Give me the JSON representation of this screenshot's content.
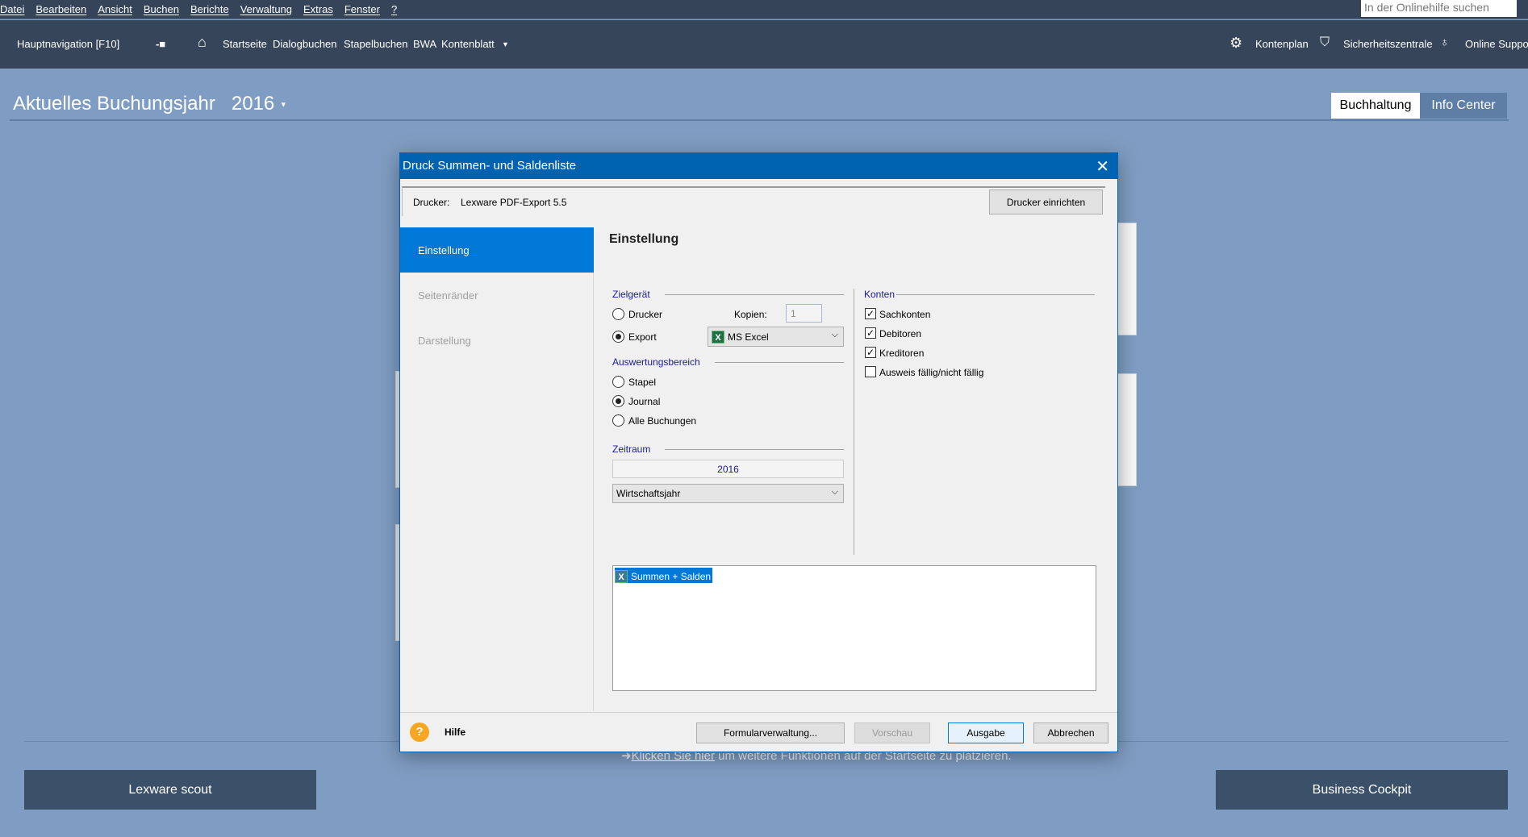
{
  "menu": [
    "Datei",
    "Bearbeiten",
    "Ansicht",
    "Buchen",
    "Berichte",
    "Verwaltung",
    "Extras",
    "Fenster",
    "?"
  ],
  "search": {
    "placeholder": "In der Onlinehilfe suchen"
  },
  "nav": {
    "main": "Hauptnavigation [F10]",
    "items": [
      "Startseite",
      "Dialogbuchen",
      "Stapelbuchen",
      "BWA",
      "Kontenblatt"
    ],
    "right": [
      "Kontenplan",
      "Sicherheitszentrale",
      "Online Support"
    ]
  },
  "header": {
    "title": "Aktuelles Buchungsjahr",
    "year": "2016",
    "tabs": [
      "Buchhaltung",
      "Info Center"
    ]
  },
  "hint": {
    "link": "Klicken Sie hier",
    "text": " um weitere Funktionen auf der Startseite zu platzieren."
  },
  "buttons": {
    "scout": "Lexware scout",
    "cockpit": "Business Cockpit"
  },
  "dialog": {
    "title": "Druck Summen- und Saldenliste",
    "printer_label": "Drucker:",
    "printer": "Lexware PDF-Export 5.5",
    "setup": "Drucker einrichten",
    "nav": [
      "Einstellung",
      "Seitenränder",
      "Darstellung"
    ],
    "heading": "Einstellung",
    "zielgeraet": "Zielgerät",
    "drucker": "Drucker",
    "export": "Export",
    "kopien_label": "Kopien:",
    "kopien": "1",
    "export_format": "MS Excel",
    "bereich": "Auswertungsbereich",
    "bereich_options": [
      "Stapel",
      "Journal",
      "Alle Buchungen"
    ],
    "bereich_selected": "Journal",
    "zeitraum": "Zeitraum",
    "zeitraum_year": "2016",
    "zeitraum_type": "Wirtschaftsjahr",
    "konten": "Konten",
    "konten_options": [
      {
        "label": "Sachkonten",
        "checked": true
      },
      {
        "label": "Debitoren",
        "checked": true
      },
      {
        "label": "Kreditoren",
        "checked": true
      },
      {
        "label": "Ausweis fällig/nicht fällig",
        "checked": false
      }
    ],
    "list": [
      "Summen + Salden"
    ],
    "help": "Hilfe",
    "footer": {
      "form": "Formularverwaltung...",
      "preview": "Vorschau",
      "output": "Ausgabe",
      "cancel": "Abbrechen"
    }
  },
  "colors": {
    "accent": "#0078d7",
    "titlebar": "#0063b1",
    "nav_bg": "#36455a",
    "page_bg": "#7f9dc2"
  }
}
